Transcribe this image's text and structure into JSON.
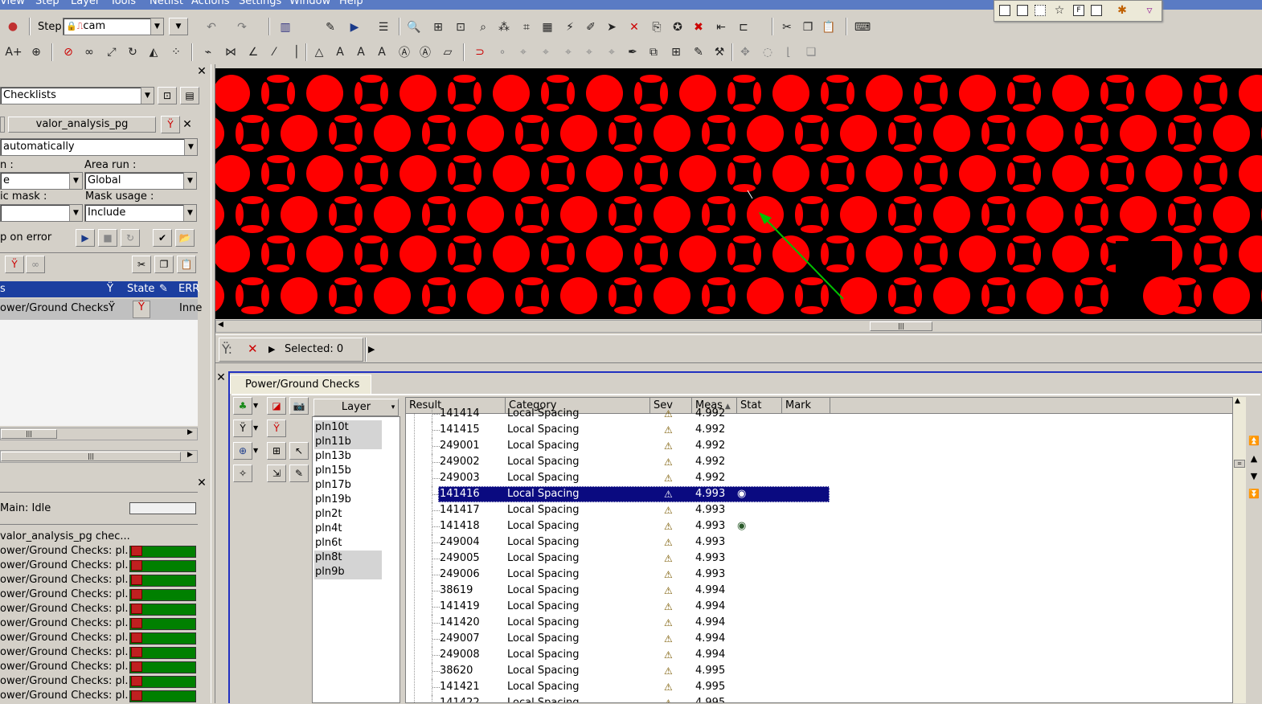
{
  "menu": [
    "View",
    "Step",
    "Layer",
    "Tools",
    "Netlist",
    "Actions",
    "Settings",
    "Window",
    "Help"
  ],
  "toolbar": {
    "step_label": "Step",
    "step_value": "cam"
  },
  "left": {
    "panel_title": "Checklists",
    "checklist_name": "valor_analysis_pg",
    "run_mode": "automatically",
    "run_label": "n :",
    "run_value": "e",
    "area_run_label": "Area run :",
    "area_run_value": "Global",
    "mask_label": "ic mask :",
    "mask_value": "",
    "mask_usage_label": "Mask usage :",
    "mask_usage_value": "Include",
    "stop_label": "p on error",
    "col_name": "s",
    "col_state": "State",
    "col_err": "ERR",
    "check_row": "ower/Ground Checks",
    "check_state": "Inne",
    "status_main": "Main: Idle",
    "progress_header": "valor_analysis_pg chec...",
    "progress_items": [
      "ower/Ground Checks: pl...",
      "ower/Ground Checks: pl...",
      "ower/Ground Checks: pl...",
      "ower/Ground Checks: pl...",
      "ower/Ground Checks: pl...",
      "ower/Ground Checks: pl...",
      "ower/Ground Checks: pl...",
      "ower/Ground Checks: pl...",
      "ower/Ground Checks: pl...",
      "ower/Ground Checks: pl...",
      "ower/Ground Checks: pl..."
    ]
  },
  "selection": {
    "selected_text": "Selected: 0"
  },
  "bottom": {
    "tab_label": "Power/Ground Checks",
    "layer_header": "Layer",
    "layers": [
      {
        "name": "pln10t",
        "sel": true
      },
      {
        "name": "pln11b",
        "sel": true
      },
      {
        "name": "pln13b",
        "sel": false
      },
      {
        "name": "pln15b",
        "sel": false
      },
      {
        "name": "pln17b",
        "sel": false
      },
      {
        "name": "pln19b",
        "sel": false
      },
      {
        "name": "pln2t",
        "sel": false
      },
      {
        "name": "pln4t",
        "sel": false
      },
      {
        "name": "pln6t",
        "sel": false
      },
      {
        "name": "pln8t",
        "sel": true
      },
      {
        "name": "pln9b",
        "sel": true
      }
    ],
    "columns": [
      "Result",
      "Category",
      "Sev",
      "Meas",
      "Stat",
      "Mark"
    ],
    "rows": [
      {
        "id": "141414",
        "cat": "Local Spacing",
        "meas": "4.992",
        "stat": ""
      },
      {
        "id": "141415",
        "cat": "Local Spacing",
        "meas": "4.992",
        "stat": ""
      },
      {
        "id": "249001",
        "cat": "Local Spacing",
        "meas": "4.992",
        "stat": ""
      },
      {
        "id": "249002",
        "cat": "Local Spacing",
        "meas": "4.992",
        "stat": ""
      },
      {
        "id": "249003",
        "cat": "Local Spacing",
        "meas": "4.992",
        "stat": ""
      },
      {
        "id": "141416",
        "cat": "Local Spacing",
        "meas": "4.993",
        "stat": "eye",
        "sel": true
      },
      {
        "id": "141417",
        "cat": "Local Spacing",
        "meas": "4.993",
        "stat": ""
      },
      {
        "id": "141418",
        "cat": "Local Spacing",
        "meas": "4.993",
        "stat": "eye"
      },
      {
        "id": "249004",
        "cat": "Local Spacing",
        "meas": "4.993",
        "stat": ""
      },
      {
        "id": "249005",
        "cat": "Local Spacing",
        "meas": "4.993",
        "stat": ""
      },
      {
        "id": "249006",
        "cat": "Local Spacing",
        "meas": "4.993",
        "stat": ""
      },
      {
        "id": "38619",
        "cat": "Local Spacing",
        "meas": "4.994",
        "stat": ""
      },
      {
        "id": "141419",
        "cat": "Local Spacing",
        "meas": "4.994",
        "stat": ""
      },
      {
        "id": "141420",
        "cat": "Local Spacing",
        "meas": "4.994",
        "stat": ""
      },
      {
        "id": "249007",
        "cat": "Local Spacing",
        "meas": "4.994",
        "stat": ""
      },
      {
        "id": "249008",
        "cat": "Local Spacing",
        "meas": "4.994",
        "stat": ""
      },
      {
        "id": "38620",
        "cat": "Local Spacing",
        "meas": "4.995",
        "stat": ""
      },
      {
        "id": "141421",
        "cat": "Local Spacing",
        "meas": "4.995",
        "stat": ""
      },
      {
        "id": "141422",
        "cat": "Local Spacing",
        "meas": "4.995",
        "stat": ""
      }
    ]
  },
  "colors": {
    "copper": "#ff0000",
    "background": "#000000",
    "selection": "#0a0a80",
    "panel_border": "#2030c0",
    "progress": "#008000",
    "arrow": "#00c000"
  }
}
